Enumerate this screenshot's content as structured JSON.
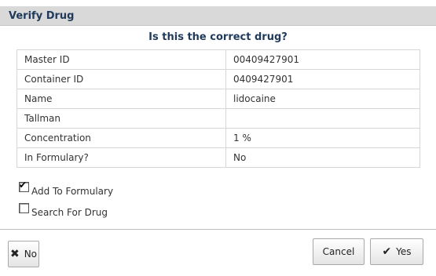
{
  "dialog": {
    "title": "Verify Drug",
    "question": "Is this the correct drug?"
  },
  "details": [
    {
      "label": "Master ID",
      "value": "00409427901"
    },
    {
      "label": "Container ID",
      "value": "0409427901"
    },
    {
      "label": "Name",
      "value": "lidocaine"
    },
    {
      "label": "Tallman",
      "value": ""
    },
    {
      "label": "Concentration",
      "value": "1 %"
    },
    {
      "label": "In Formulary?",
      "value": "No"
    }
  ],
  "options": {
    "add_to_formulary": {
      "label": "Add To Formulary",
      "checked": true
    },
    "search_for_drug": {
      "label": "Search For Drug",
      "checked": false
    }
  },
  "buttons": {
    "no_label": "No",
    "no_icon": "x-icon",
    "cancel_label": "Cancel",
    "yes_label": "Yes",
    "yes_icon": "checkmark-icon"
  }
}
